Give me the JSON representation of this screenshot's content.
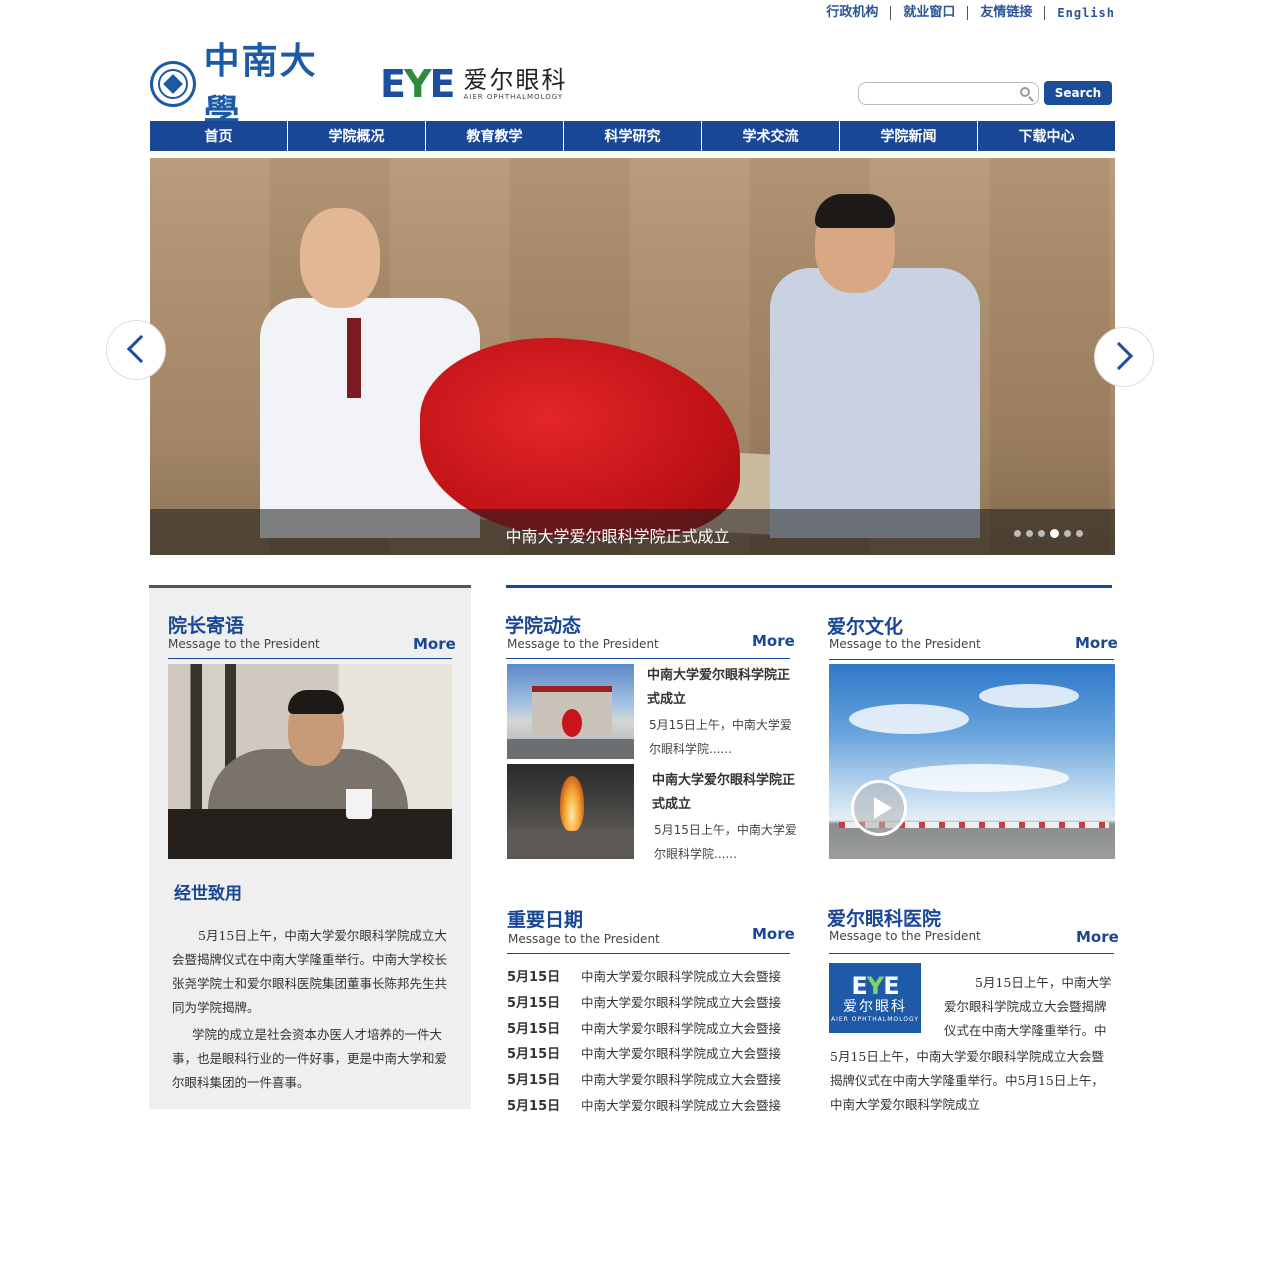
{
  "top_links": [
    "行政机构",
    "就业窗口",
    "友情链接",
    "English"
  ],
  "logos": {
    "csu_name": "中南大學",
    "eye_mark": [
      "E",
      "Y",
      "E"
    ],
    "eye_cn": "爱尔眼科",
    "eye_en": "AIER OPHTHALMOLOGY"
  },
  "search": {
    "placeholder": "",
    "button": "Search"
  },
  "nav": [
    "首页",
    "学院概况",
    "教育教学",
    "科学研究",
    "学术交流",
    "学院新闻",
    "下载中心"
  ],
  "banner": {
    "caption": "中南大学爱尔眼科学院正式成立",
    "slide_count": 6,
    "active_slide": 4
  },
  "president": {
    "title": "院长寄语",
    "subtitle": "Message to the President",
    "more": "More",
    "motto": "经世致用",
    "para1": "5月15日上午，中南大学爱尔眼科学院成立大会暨揭牌仪式在中南大学隆重举行。中南大学校长张尧学院士和爱尔眼科医院集团董事长陈邦先生共同为学院揭牌。",
    "para2": "学院的成立是社会资本办医人才培养的一件大事，也是眼科行业的一件好事，更是中南大学和爱尔眼科集团的一件喜事。"
  },
  "news": {
    "title": "学院动态",
    "subtitle": "Message to the President",
    "more": "More",
    "items": [
      {
        "title": "中南大学爱尔眼科学院正式成立",
        "desc": "5月15日上午，中南大学爱尔眼科学院......"
      },
      {
        "title": "中南大学爱尔眼科学院正式成立",
        "desc": "5月15日上午，中南大学爱尔眼科学院......"
      }
    ]
  },
  "culture": {
    "title": "爱尔文化",
    "subtitle": "Message to the President",
    "more": "More"
  },
  "dates": {
    "title": "重要日期",
    "subtitle": "Message to the President",
    "more": "More",
    "rows": [
      {
        "date": "5月15日",
        "text": "中南大学爱尔眼科学院成立大会暨接"
      },
      {
        "date": "5月15日",
        "text": "中南大学爱尔眼科学院成立大会暨接"
      },
      {
        "date": "5月15日",
        "text": "中南大学爱尔眼科学院成立大会暨接"
      },
      {
        "date": "5月15日",
        "text": "中南大学爱尔眼科学院成立大会暨接"
      },
      {
        "date": "5月15日",
        "text": "中南大学爱尔眼科学院成立大会暨接"
      },
      {
        "date": "5月15日",
        "text": "中南大学爱尔眼科学院成立大会暨接"
      }
    ]
  },
  "hospital": {
    "title": "爱尔眼科医院",
    "subtitle": "Message to the President",
    "more": "More",
    "logo_cn": "爱尔眼科",
    "logo_en": "AIER OPHTHALMOLOGY",
    "line1": "5月15日上午，中南大学",
    "line2": "爱尔眼科学院成立大会暨揭牌",
    "line3": "仪式在中南大学隆重举行。中",
    "line4": "5月15日上午，中南大学爱尔眼科学院成立大会暨",
    "line5": "揭牌仪式在中南大学隆重举行。中5月15日上午，",
    "line6": "中南大学爱尔眼科学院成立"
  },
  "colors": {
    "brand_blue": "#1a4795",
    "nav_blue": "#1a4795",
    "panel_gray": "#efefef"
  }
}
